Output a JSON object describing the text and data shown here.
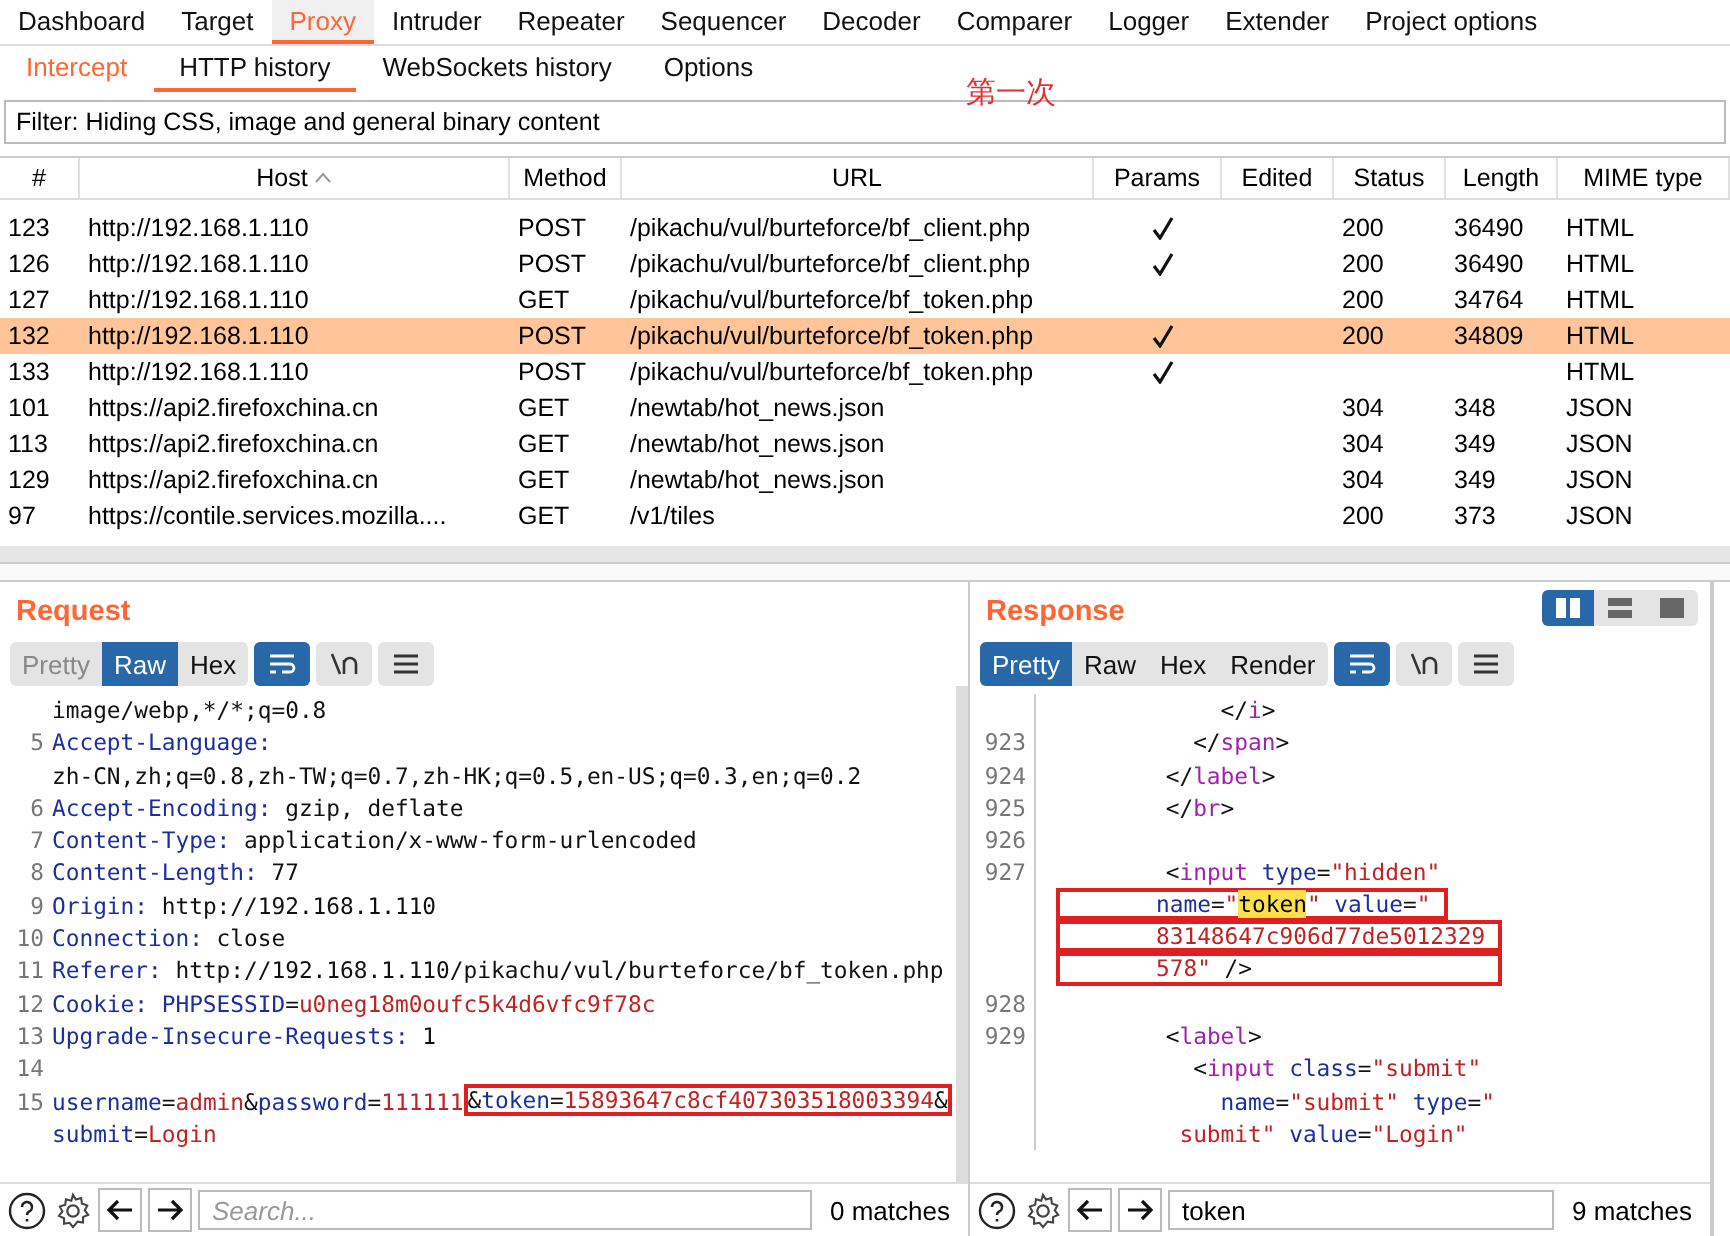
{
  "tabs": [
    {
      "label": "Dashboard",
      "selected": false
    },
    {
      "label": "Target",
      "selected": false
    },
    {
      "label": "Proxy",
      "selected": true
    },
    {
      "label": "Intruder",
      "selected": false
    },
    {
      "label": "Repeater",
      "selected": false
    },
    {
      "label": "Sequencer",
      "selected": false
    },
    {
      "label": "Decoder",
      "selected": false
    },
    {
      "label": "Comparer",
      "selected": false
    },
    {
      "label": "Logger",
      "selected": false
    },
    {
      "label": "Extender",
      "selected": false
    },
    {
      "label": "Project options",
      "selected": false
    }
  ],
  "subtabs": [
    {
      "label": "Intercept",
      "selected": false,
      "highlighted": true
    },
    {
      "label": "HTTP history",
      "selected": true,
      "highlighted": false
    },
    {
      "label": "WebSockets history",
      "selected": false,
      "highlighted": false
    },
    {
      "label": "Options",
      "selected": false,
      "highlighted": false
    }
  ],
  "annotation": "第一次",
  "filter": "Filter: Hiding CSS, image and general binary content",
  "table": {
    "columns": [
      "#",
      "Host",
      "Method",
      "URL",
      "Params",
      "Edited",
      "Status",
      "Length",
      "MIME type"
    ],
    "rows": [
      {
        "id": "123",
        "host": "http://192.168.1.110",
        "method": "POST",
        "url": "/pikachu/vul/burteforce/bf_client.php",
        "params": true,
        "status": "200",
        "length": "36490",
        "mime": "HTML",
        "selected": false
      },
      {
        "id": "126",
        "host": "http://192.168.1.110",
        "method": "POST",
        "url": "/pikachu/vul/burteforce/bf_client.php",
        "params": true,
        "status": "200",
        "length": "36490",
        "mime": "HTML",
        "selected": false
      },
      {
        "id": "127",
        "host": "http://192.168.1.110",
        "method": "GET",
        "url": "/pikachu/vul/burteforce/bf_token.php",
        "params": false,
        "status": "200",
        "length": "34764",
        "mime": "HTML",
        "selected": false
      },
      {
        "id": "132",
        "host": "http://192.168.1.110",
        "method": "POST",
        "url": "/pikachu/vul/burteforce/bf_token.php",
        "params": true,
        "status": "200",
        "length": "34809",
        "mime": "HTML",
        "selected": true
      },
      {
        "id": "133",
        "host": "http://192.168.1.110",
        "method": "POST",
        "url": "/pikachu/vul/burteforce/bf_token.php",
        "params": true,
        "mime": "HTML",
        "selected": false
      },
      {
        "id": "101",
        "host": "https://api2.firefoxchina.cn",
        "method": "GET",
        "url": "/newtab/hot_news.json",
        "params": false,
        "status": "304",
        "length": "348",
        "mime": "JSON",
        "selected": false
      },
      {
        "id": "113",
        "host": "https://api2.firefoxchina.cn",
        "method": "GET",
        "url": "/newtab/hot_news.json",
        "params": false,
        "status": "304",
        "length": "349",
        "mime": "JSON",
        "selected": false
      },
      {
        "id": "129",
        "host": "https://api2.firefoxchina.cn",
        "method": "GET",
        "url": "/newtab/hot_news.json",
        "params": false,
        "status": "304",
        "length": "349",
        "mime": "JSON",
        "selected": false
      },
      {
        "id": "97",
        "host": "https://contile.services.mozilla....",
        "method": "GET",
        "url": "/v1/tiles",
        "params": false,
        "status": "200",
        "length": "373",
        "mime": "JSON",
        "selected": false
      }
    ]
  },
  "layout_buttons": [
    {
      "selected": true
    },
    {
      "selected": false
    },
    {
      "selected": false
    }
  ],
  "request": {
    "title": "Request",
    "views": [
      {
        "label": "Pretty",
        "selected": false,
        "disabled": true
      },
      {
        "label": "Raw",
        "selected": true,
        "disabled": false
      },
      {
        "label": "Hex",
        "selected": false,
        "disabled": false
      }
    ],
    "lines": [
      {
        "segments": [
          {
            "kind": "text",
            "text": "image/webp,*/*;q=0.8"
          }
        ]
      },
      {
        "number": "5",
        "segments": [
          {
            "kind": "key",
            "text": "Accept-Language:"
          }
        ]
      },
      {
        "segments": [
          {
            "kind": "text",
            "text": "zh-CN,zh;q=0.8,zh-TW;q=0.7,zh-HK;q=0.5,en-US;q=0.3,en;q=0.2"
          }
        ]
      },
      {
        "number": "6",
        "segments": [
          {
            "kind": "key",
            "text": "Accept-Encoding:"
          },
          {
            "kind": "text",
            "text": " gzip, deflate"
          }
        ]
      },
      {
        "number": "7",
        "segments": [
          {
            "kind": "key",
            "text": "Content-Type:"
          },
          {
            "kind": "text",
            "text": " application/x-www-form-urlencoded"
          }
        ]
      },
      {
        "number": "8",
        "segments": [
          {
            "kind": "key",
            "text": "Content-Length:"
          },
          {
            "kind": "text",
            "text": " 77"
          }
        ]
      },
      {
        "number": "9",
        "segments": [
          {
            "kind": "key",
            "text": "Origin:"
          },
          {
            "kind": "text",
            "text": " http://192.168.1.110"
          }
        ]
      },
      {
        "number": "10",
        "segments": [
          {
            "kind": "key",
            "text": "Connection:"
          },
          {
            "kind": "text",
            "text": " close"
          }
        ]
      },
      {
        "number": "11",
        "segments": [
          {
            "kind": "key",
            "text": "Referer:"
          },
          {
            "kind": "text",
            "text": " http://192.168.1.110/pikachu/vul/burteforce/bf_token.php"
          }
        ]
      },
      {
        "number": "12",
        "segments": [
          {
            "kind": "key",
            "text": "Cookie: PHPSESSID"
          },
          {
            "kind": "text",
            "text": "="
          },
          {
            "kind": "value",
            "text": "u0neg18m0oufc5k4d6vfc9f78c"
          }
        ]
      },
      {
        "number": "13",
        "segments": [
          {
            "kind": "key",
            "text": "Upgrade-Insecure-Requests:"
          },
          {
            "kind": "text",
            "text": " 1"
          }
        ]
      },
      {
        "number": "14"
      },
      {
        "number": "15",
        "segments": [
          {
            "kind": "key",
            "text": "username"
          },
          {
            "kind": "text",
            "text": "="
          },
          {
            "kind": "value",
            "text": "admin"
          },
          {
            "kind": "text",
            "text": "&"
          },
          {
            "kind": "key",
            "text": "password"
          },
          {
            "kind": "text",
            "text": "="
          },
          {
            "kind": "value",
            "text": "111111"
          }
        ],
        "boxed": [
          {
            "kind": "text",
            "text": "&"
          },
          {
            "kind": "key",
            "text": "token"
          },
          {
            "kind": "text",
            "text": "="
          },
          {
            "kind": "value",
            "text": "15893647c8cf407303518003394"
          },
          {
            "kind": "text",
            "text": "&"
          }
        ]
      },
      {
        "segments": [
          {
            "kind": "key",
            "text": "submit"
          },
          {
            "kind": "text",
            "text": "="
          },
          {
            "kind": "value",
            "text": "Login"
          }
        ]
      }
    ],
    "search": {
      "placeholder": "Search...",
      "matches": "0 matches"
    }
  },
  "response": {
    "title": "Response",
    "views": [
      {
        "label": "Pretty",
        "selected": true,
        "disabled": false
      },
      {
        "label": "Raw",
        "selected": false,
        "disabled": false
      },
      {
        "label": "Hex",
        "selected": false,
        "disabled": false
      },
      {
        "label": "Render",
        "selected": false,
        "disabled": false
      }
    ],
    "lines": [
      {
        "segments": [
          {
            "kind": "text",
            "text": "            </"
          },
          {
            "kind": "tag",
            "text": "i"
          },
          {
            "kind": "text",
            "text": ">"
          }
        ]
      },
      {
        "number": "923",
        "segments": [
          {
            "kind": "text",
            "text": "          </"
          },
          {
            "kind": "tag",
            "text": "span"
          },
          {
            "kind": "text",
            "text": ">"
          }
        ]
      },
      {
        "number": "924",
        "segments": [
          {
            "kind": "text",
            "text": "        </"
          },
          {
            "kind": "tag",
            "text": "label"
          },
          {
            "kind": "text",
            "text": ">"
          }
        ]
      },
      {
        "number": "925",
        "segments": [
          {
            "kind": "text",
            "text": "        </"
          },
          {
            "kind": "tag",
            "text": "br"
          },
          {
            "kind": "text",
            "text": ">"
          }
        ]
      },
      {
        "number": "926"
      },
      {
        "number": "927",
        "segments": [
          {
            "kind": "text",
            "text": "        <"
          },
          {
            "kind": "tag",
            "text": "input"
          },
          {
            "kind": "key",
            "text": " type"
          },
          {
            "kind": "text",
            "text": "="
          },
          {
            "kind": "value",
            "text": "\"hidden\""
          }
        ]
      },
      {
        "boxed": [
          {
            "kind": "key",
            "text": "       name"
          },
          {
            "kind": "text",
            "text": "="
          },
          {
            "kind": "value",
            "text": "\""
          },
          {
            "kind": "match",
            "text": "token"
          },
          {
            "kind": "value",
            "text": "\""
          },
          {
            "kind": "key",
            "text": " value"
          },
          {
            "kind": "text",
            "text": "="
          },
          {
            "kind": "value",
            "text": "\" "
          }
        ]
      },
      {
        "boxed": [
          {
            "kind": "value",
            "text": "       83148647c906d77de5012329 "
          }
        ]
      },
      {
        "boxed": [
          {
            "kind": "value",
            "text": "       578\""
          },
          {
            "kind": "text",
            "text": " />                  "
          }
        ]
      },
      {
        "number": "928"
      },
      {
        "number": "929",
        "segments": [
          {
            "kind": "text",
            "text": "        <"
          },
          {
            "kind": "tag",
            "text": "label"
          },
          {
            "kind": "text",
            "text": ">"
          }
        ]
      },
      {
        "segments": [
          {
            "kind": "text",
            "text": "          <"
          },
          {
            "kind": "tag",
            "text": "input"
          },
          {
            "kind": "key",
            "text": " class"
          },
          {
            "kind": "text",
            "text": "="
          },
          {
            "kind": "value",
            "text": "\"submit\""
          }
        ]
      },
      {
        "segments": [
          {
            "kind": "key",
            "text": "            name"
          },
          {
            "kind": "text",
            "text": "="
          },
          {
            "kind": "value",
            "text": "\"submit\""
          },
          {
            "kind": "key",
            "text": " type"
          },
          {
            "kind": "text",
            "text": "="
          },
          {
            "kind": "value",
            "text": "\""
          }
        ]
      },
      {
        "segments": [
          {
            "kind": "value",
            "text": "         submit\""
          },
          {
            "kind": "key",
            "text": " value"
          },
          {
            "kind": "text",
            "text": "="
          },
          {
            "kind": "value",
            "text": "\"Login\""
          }
        ]
      }
    ],
    "search": {
      "value": "token",
      "matches": "9 matches"
    }
  }
}
